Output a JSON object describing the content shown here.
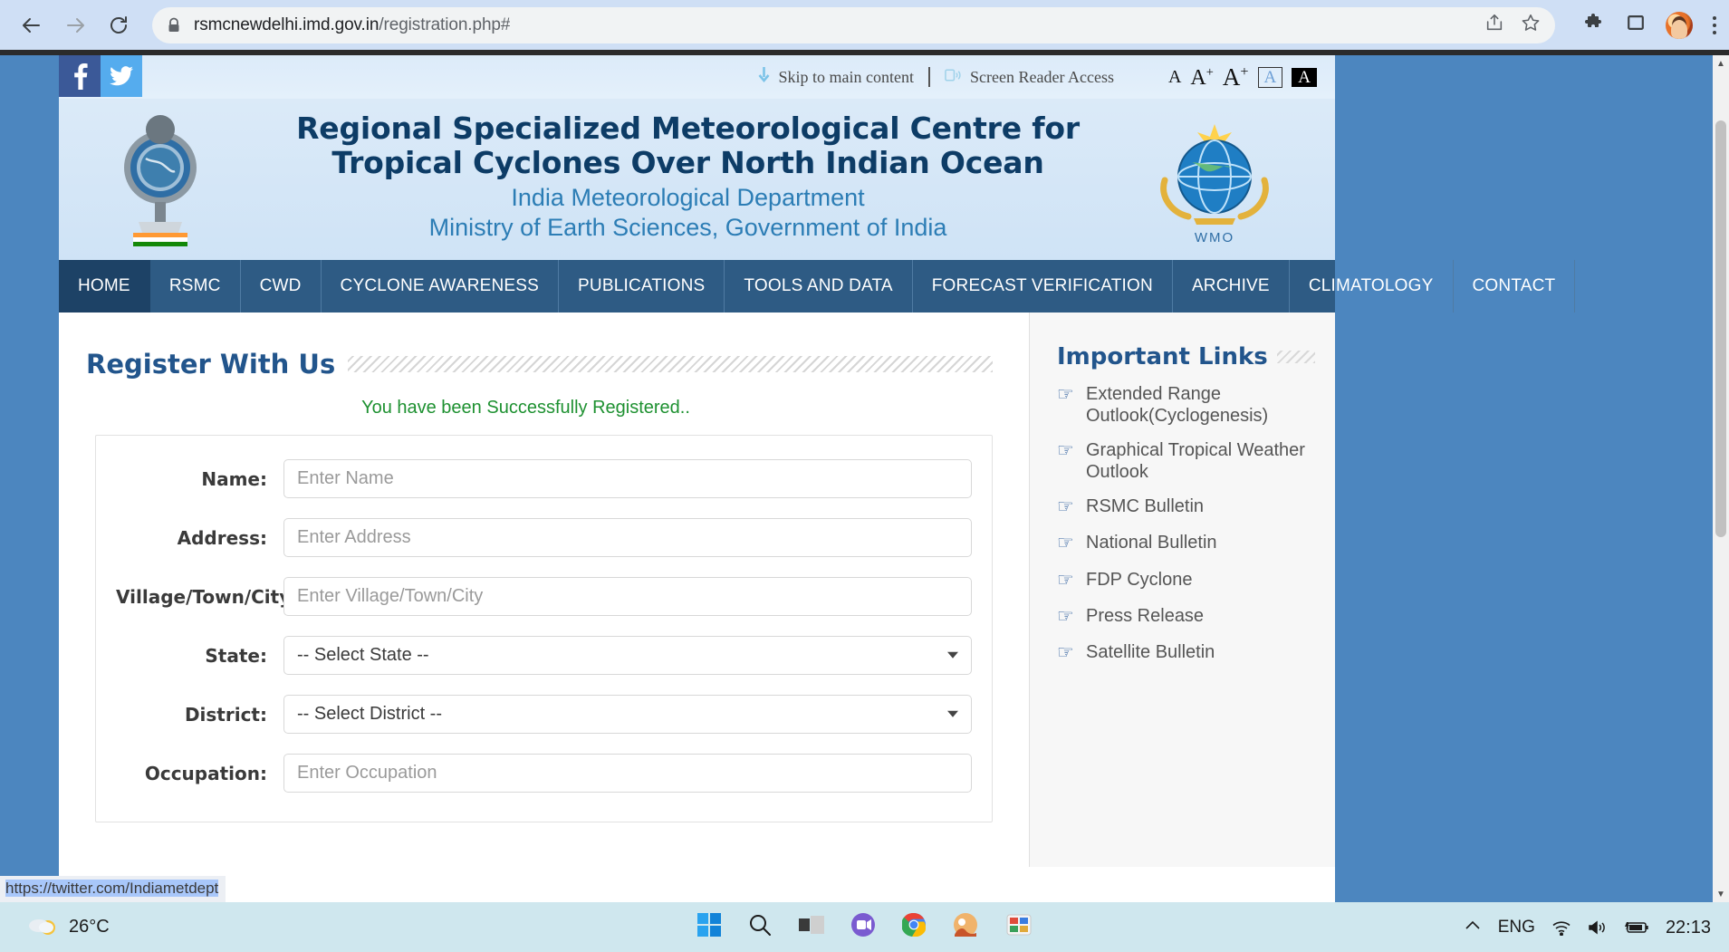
{
  "browser": {
    "back_icon": "back-arrow-icon",
    "forward_icon": "forward-arrow-icon",
    "reload_icon": "reload-icon",
    "lock_icon": "lock-icon",
    "url_host": "rsmcnewdelhi.imd.gov.in",
    "url_path": "/registration.php#",
    "share_icon": "share-icon",
    "bookmark_icon": "star-icon",
    "extensions_icon": "puzzle-icon",
    "sidepanel_icon": "side-panel-icon",
    "profile_icon": "profile-avatar",
    "menu_icon": "three-dot-menu-icon"
  },
  "accessibility": {
    "skip_link": "Skip to main content",
    "screen_reader": "Screen Reader Access",
    "font_normal": "A",
    "font_medium": "A",
    "font_large": "A",
    "font_plus": "+",
    "contrast_light": "A",
    "contrast_dark": "A"
  },
  "social": {
    "facebook": "f",
    "twitter": "twitter-icon"
  },
  "header": {
    "title_line1": "Regional Specialized Meteorological Centre for",
    "title_line2": "Tropical Cyclones Over North Indian Ocean",
    "subtitle_line1": "India Meteorological Department",
    "subtitle_line2": "Ministry of Earth Sciences, Government of India",
    "emblem_alt": "india-state-emblem",
    "wmo_alt": "wmo-logo",
    "wmo_label": "WMO"
  },
  "nav": {
    "items": [
      {
        "label": "HOME",
        "active": true
      },
      {
        "label": "RSMC",
        "active": false
      },
      {
        "label": "CWD",
        "active": false
      },
      {
        "label": "CYCLONE AWARENESS",
        "active": false
      },
      {
        "label": "PUBLICATIONS",
        "active": false
      },
      {
        "label": "TOOLS AND DATA",
        "active": false
      },
      {
        "label": "FORECAST VERIFICATION",
        "active": false
      },
      {
        "label": "ARCHIVE",
        "active": false
      },
      {
        "label": "CLIMATOLOGY",
        "active": false
      },
      {
        "label": "CONTACT",
        "active": false
      }
    ]
  },
  "main": {
    "page_title": "Register With Us",
    "success_message": "You have been Successfully Registered..",
    "fields": [
      {
        "label": "Name:",
        "placeholder": "Enter Name",
        "type": "text"
      },
      {
        "label": "Address:",
        "placeholder": "Enter Address",
        "type": "text"
      },
      {
        "label": "Village/Town/City:",
        "placeholder": "Enter Village/Town/City",
        "type": "text"
      },
      {
        "label": "State:",
        "placeholder": "-- Select State --",
        "type": "select"
      },
      {
        "label": "District:",
        "placeholder": "-- Select District --",
        "type": "select"
      },
      {
        "label": "Occupation:",
        "placeholder": "Enter Occupation",
        "type": "text"
      }
    ]
  },
  "sidebar": {
    "title": "Important Links",
    "links": [
      {
        "label": "Extended Range Outlook(Cyclogenesis)"
      },
      {
        "label": "Graphical Tropical Weather Outlook"
      },
      {
        "label": "RSMC Bulletin"
      },
      {
        "label": "National Bulletin"
      },
      {
        "label": "FDP Cyclone"
      },
      {
        "label": "Press Release"
      },
      {
        "label": "Satellite Bulletin"
      }
    ]
  },
  "status": {
    "link_target": "https://twitter.com/Indiametdept"
  },
  "taskbar": {
    "weather_temp": "26°C",
    "start_icon": "windows-start-icon",
    "search_icon": "search-icon",
    "taskview_icon": "task-view-icon",
    "teams_icon": "teams-icon",
    "chrome_icon": "chrome-icon",
    "photos_icon": "photos-icon",
    "app_icon": "app-icon",
    "overflow_icon": "show-hidden-icons-icon",
    "language": "ENG",
    "network_icon": "wifi-icon",
    "volume_icon": "volume-icon",
    "battery_icon": "battery-charging-icon",
    "clock": "22:13"
  },
  "colors": {
    "nav_bg": "#2e5b84",
    "nav_active": "#1d4266",
    "title_navy": "#0d3c66",
    "subtitle_blue": "#2c7db5",
    "success_green": "#1e9131",
    "heading_blue": "#22558c",
    "facebook": "#3b5998",
    "twitter": "#55acee"
  }
}
